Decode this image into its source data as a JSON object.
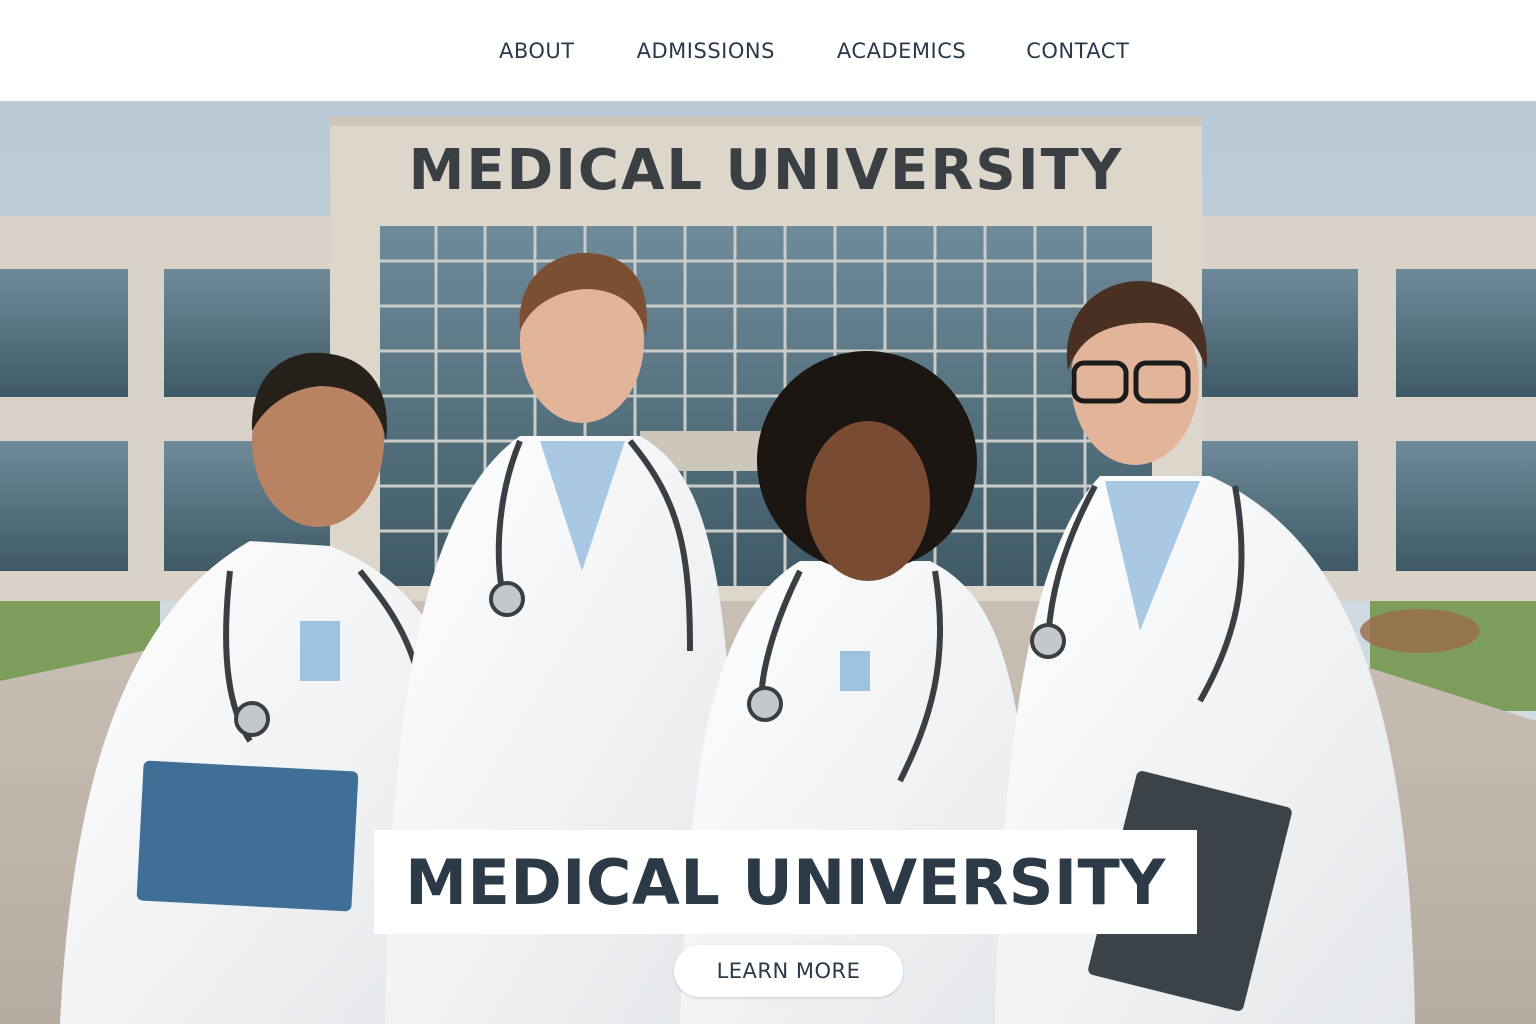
{
  "nav": {
    "items": [
      {
        "label": "ABOUT"
      },
      {
        "label": "ADMISSIONS"
      },
      {
        "label": "ACADEMICS"
      },
      {
        "label": "CONTACT"
      }
    ]
  },
  "hero": {
    "building_sign": "MEDICAL UNIVERSITY",
    "title": "MEDICAL UNIVERSITY",
    "cta_label": "LEARN MORE",
    "image_description_icon": "group-photo-image"
  },
  "colors": {
    "text_dark": "#2c3a47",
    "nav_text": "#2b3a4a",
    "background": "#ffffff",
    "sky": "#c9d6df",
    "building": "#d8d1c6"
  }
}
